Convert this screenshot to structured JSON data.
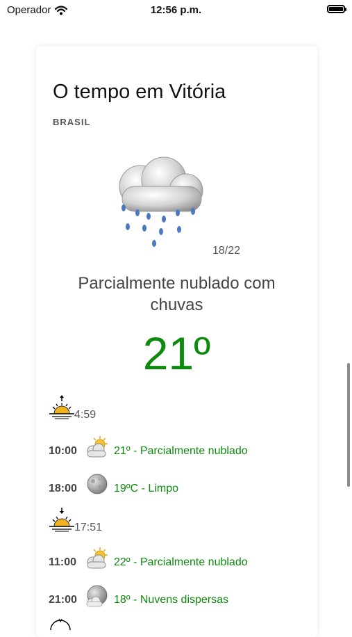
{
  "status": {
    "carrier": "Operador",
    "time": "12:56 p.m."
  },
  "header": {
    "title": "O tempo em Vitória",
    "country": "BRASIL"
  },
  "current": {
    "minmax": "18/22",
    "condition": "Parcialmente nublado com chuvas",
    "temperature": "21º",
    "icon": "rain-cloud-icon"
  },
  "days": [
    {
      "sun_event": "sunrise",
      "sun_time": "4:59",
      "forecasts": [
        {
          "time": "10:00",
          "icon": "partly-cloudy-icon",
          "text": "21º - Parcialmente nublado"
        },
        {
          "time": "18:00",
          "icon": "moon-icon",
          "text": "19ºC - Limpo"
        }
      ]
    },
    {
      "sun_event": "sunset",
      "sun_time": "17:51",
      "forecasts": [
        {
          "time": "11:00",
          "icon": "partly-cloudy-icon",
          "text": "22º - Parcialmente nublado"
        },
        {
          "time": "21:00",
          "icon": "cloudy-moon-icon",
          "text": "18º - Nuvens dispersas"
        }
      ]
    }
  ],
  "colors": {
    "accent_green": "#0c8a0c",
    "text_gray": "#555555"
  }
}
